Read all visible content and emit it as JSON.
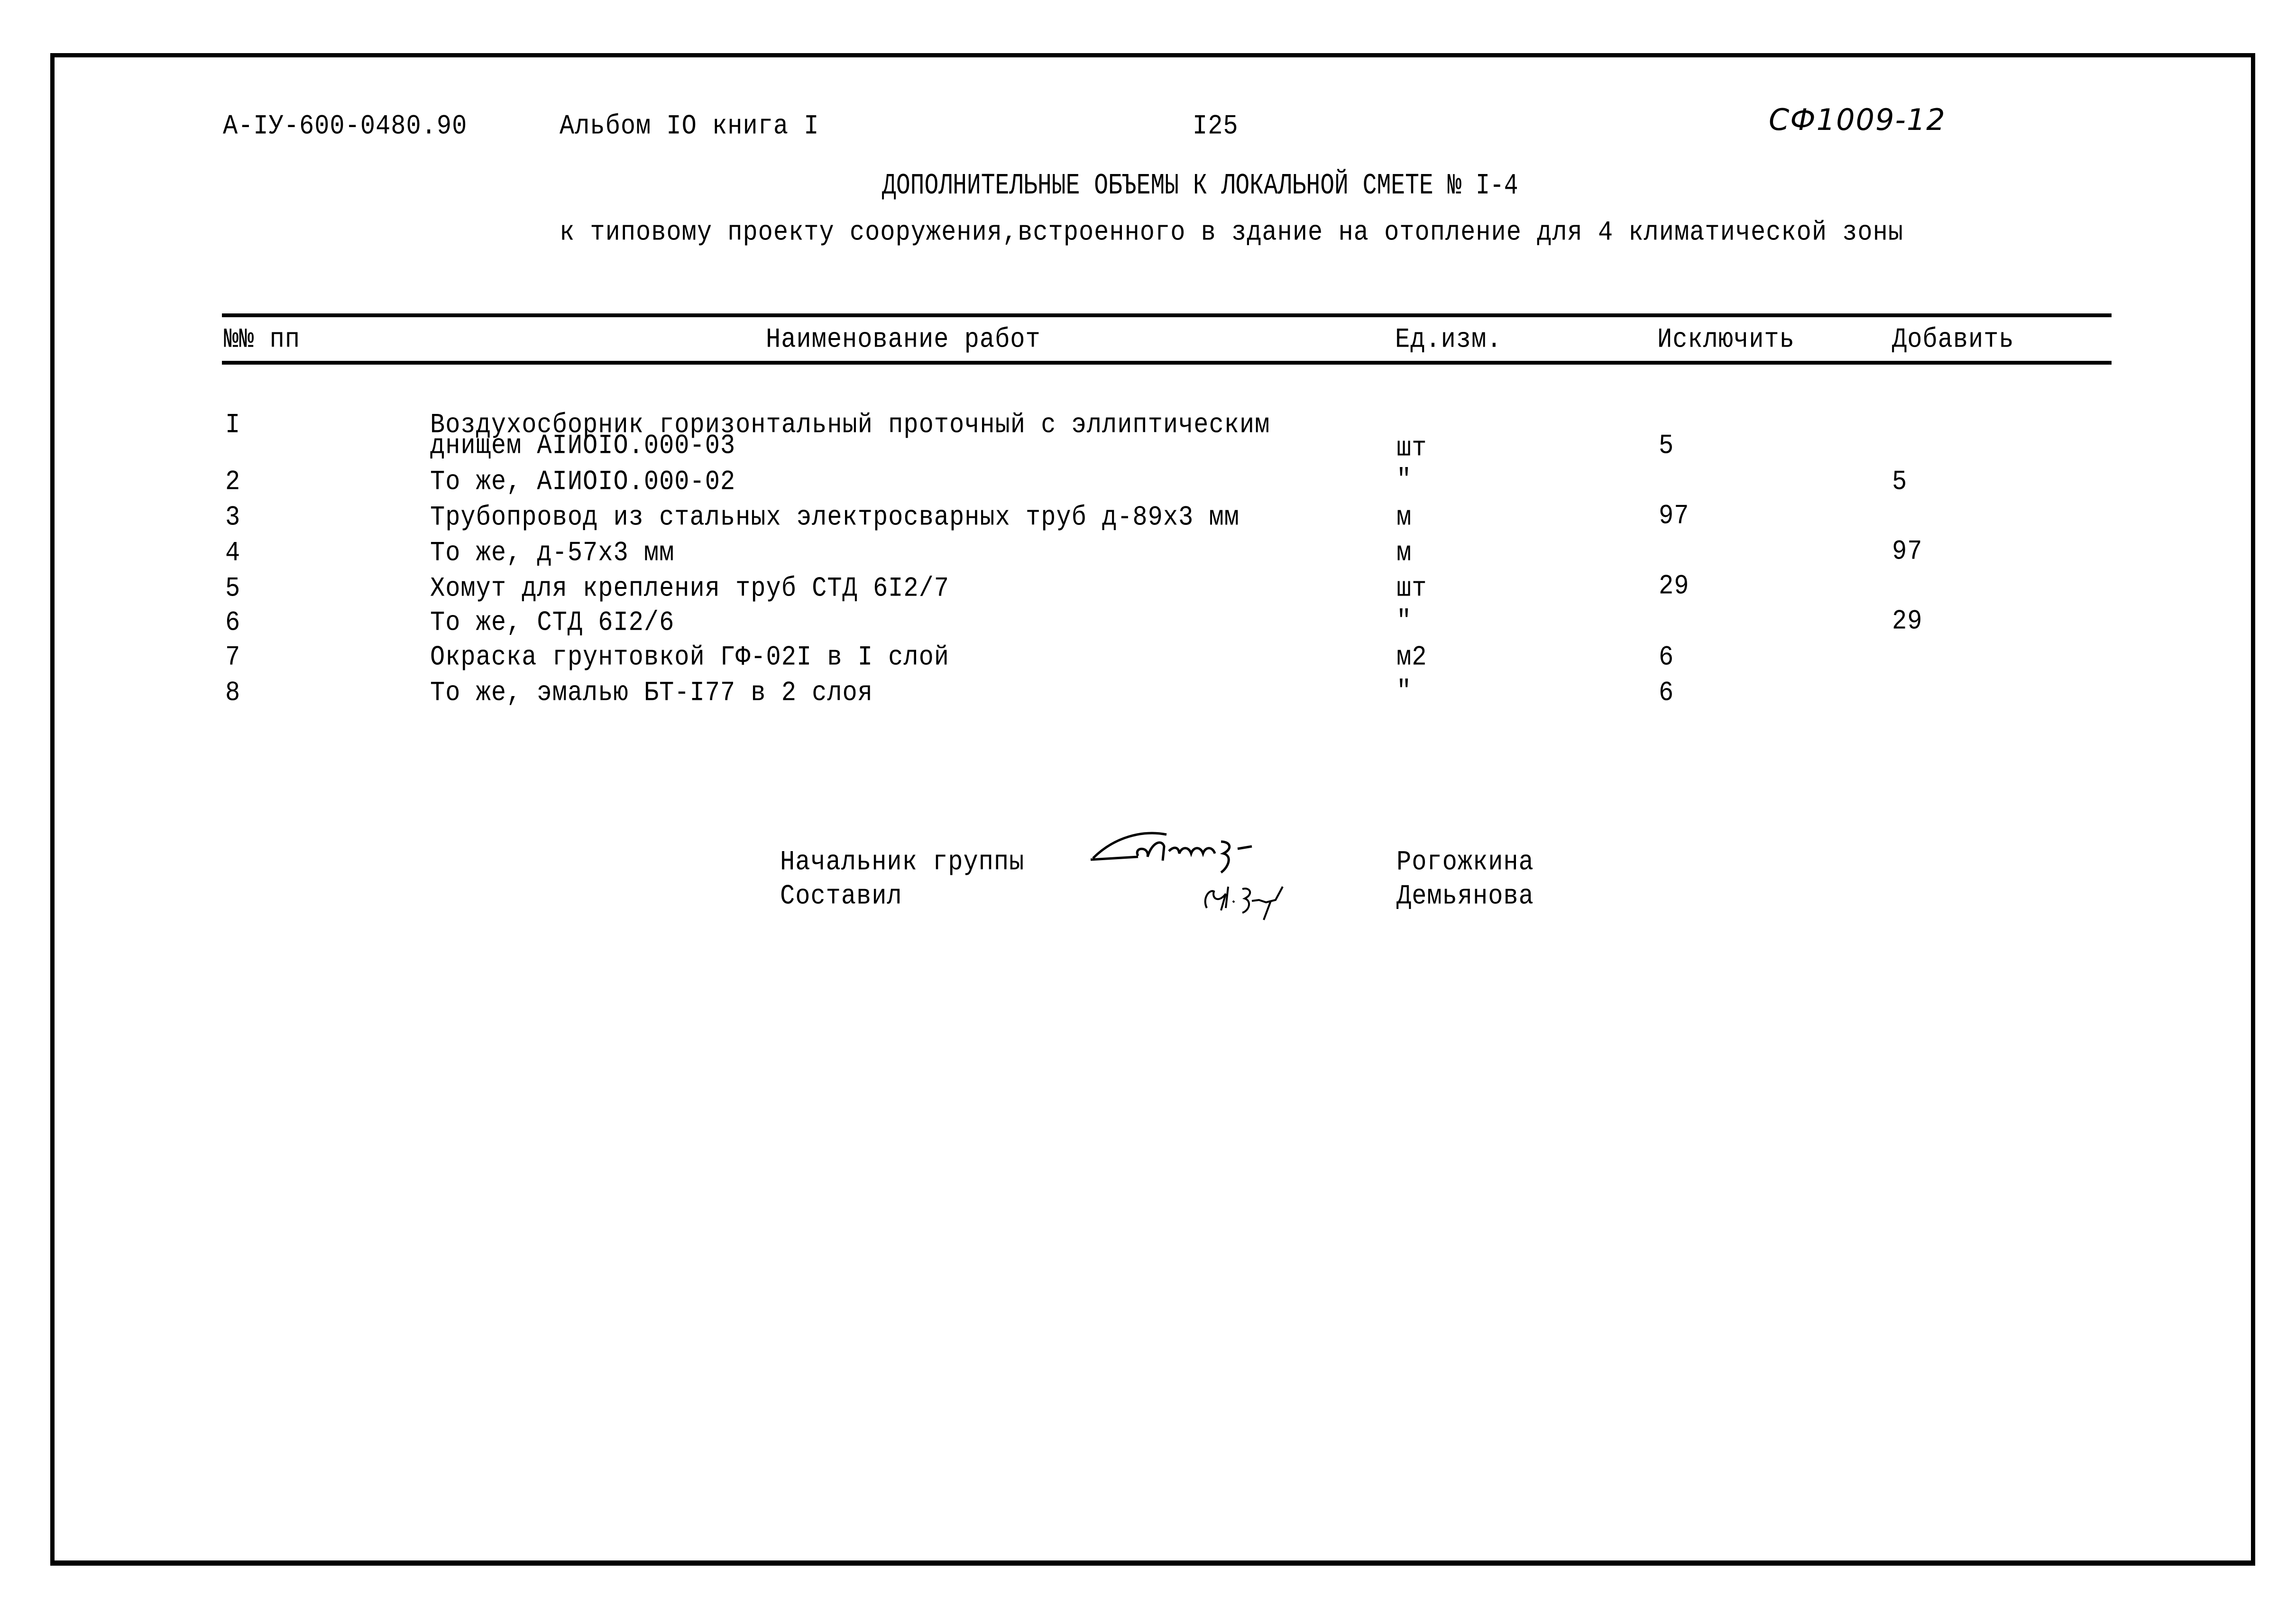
{
  "header": {
    "doc_code": "А-IУ-600-0480.90",
    "album": "Альбом IO книга I",
    "page_number": "I25",
    "stamp": "СФ1009-12"
  },
  "title": "ДОПОЛНИТЕЛЬНЫЕ ОБЪЕМЫ К ЛОКАЛЬНОЙ СМЕТЕ № I-4",
  "subtitle": "к типовому проекту сооружения,встроенного в здание на отопление для 4 климатической зоны",
  "table": {
    "columns": {
      "num": "№№ пп",
      "name": "Наименование работ",
      "unit": "Ед.изм.",
      "exclude": "Исключить",
      "add": "Добавить"
    },
    "rows": [
      {
        "num": "I",
        "name_line1": "Воздухосборник горизонтальный проточный с эллиптическим",
        "name_line2": "днищем АIИOIO.000-03",
        "unit": "шт",
        "exclude": "5",
        "add": ""
      },
      {
        "num": "2",
        "name_line1": "То же, АIИOIO.000-02",
        "unit": "\"",
        "exclude": "",
        "add": "5"
      },
      {
        "num": "3",
        "name_line1": "Трубопровод из стальных электросварных труб д-89х3 мм",
        "unit": "м",
        "exclude": "97",
        "add": ""
      },
      {
        "num": "4",
        "name_line1": "То же, д-57х3 мм",
        "unit": "м",
        "exclude": "",
        "add": "97"
      },
      {
        "num": "5",
        "name_line1": "Хомут для крепления труб СТД 6I2/7",
        "unit": "шт",
        "exclude": "29",
        "add": ""
      },
      {
        "num": "6",
        "name_line1": "То же, СТД 6I2/6",
        "unit": "\"",
        "exclude": "",
        "add": "29"
      },
      {
        "num": "7",
        "name_line1": "Окраска грунтовкой ГФ-02I в I слой",
        "unit": "м2",
        "exclude": "6",
        "add": ""
      },
      {
        "num": "8",
        "name_line1": "То же, эмалью БТ-I77 в 2 слоя",
        "unit": "\"",
        "exclude": "6",
        "add": ""
      }
    ]
  },
  "signatures": [
    {
      "role": "Начальник группы",
      "name": "Рогожкина"
    },
    {
      "role": "Составил",
      "name": "Демьянова"
    }
  ]
}
